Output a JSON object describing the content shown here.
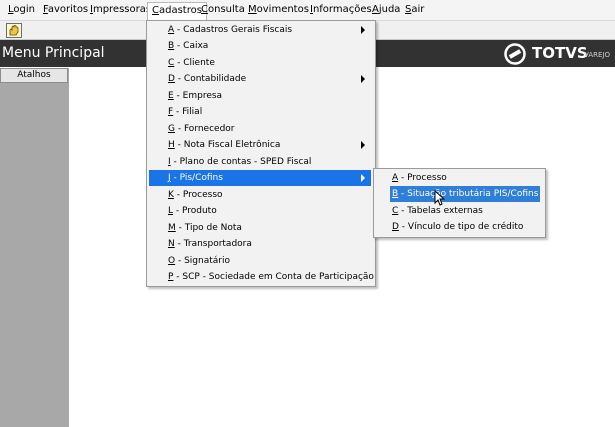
{
  "menubar": {
    "items": [
      {
        "label": "Login",
        "accel": "L",
        "rest": "ogin"
      },
      {
        "label": "Favoritos",
        "accel": "F",
        "rest": "avoritos"
      },
      {
        "label": "Impressoras",
        "accel": "I",
        "rest": "mpressoras"
      },
      {
        "label": "Cadastros",
        "accel": "C",
        "rest": "adastros"
      },
      {
        "label": "Consulta",
        "accel": "C",
        "rest": "onsulta"
      },
      {
        "label": "Movimentos",
        "accel": "M",
        "rest": "ovimentos"
      },
      {
        "label": "Informações",
        "accel": "I",
        "rest": "nformações"
      },
      {
        "label": "Ajuda",
        "accel": "A",
        "rest": "juda"
      },
      {
        "label": "Sair",
        "accel": "S",
        "rest": "air"
      }
    ]
  },
  "toolbar": {
    "button_icon": "hand-icon"
  },
  "header": {
    "title": "Menu Principal",
    "logo_text": "TOTVS",
    "logo_sub": "VAREJO"
  },
  "sidebar": {
    "tab_label": "Atalhos"
  },
  "cadastros_menu": {
    "items": [
      {
        "key": "A",
        "label": " - Cadastros Gerais Fiscais",
        "submenu": true
      },
      {
        "key": "B",
        "label": " - Caixa",
        "submenu": false
      },
      {
        "key": "C",
        "label": " - Cliente",
        "submenu": false
      },
      {
        "key": "D",
        "label": " - Contabilidade",
        "submenu": true
      },
      {
        "key": "E",
        "label": " - Empresa",
        "submenu": false
      },
      {
        "key": "F",
        "label": " - Filial",
        "submenu": false
      },
      {
        "key": "G",
        "label": " - Fornecedor",
        "submenu": false
      },
      {
        "key": "H",
        "label": " - Nota Fiscal Eletrônica",
        "submenu": true
      },
      {
        "key": "I",
        "label": " - Plano de contas - SPED Fiscal",
        "submenu": false
      },
      {
        "key": "J",
        "label": " - Pis/Cofins",
        "submenu": true,
        "highlighted": true
      },
      {
        "key": "K",
        "label": " - Processo",
        "submenu": false
      },
      {
        "key": "L",
        "label": " - Produto",
        "submenu": false
      },
      {
        "key": "M",
        "label": " - Tipo de Nota",
        "submenu": false
      },
      {
        "key": "N",
        "label": " - Transportadora",
        "submenu": false
      },
      {
        "key": "O",
        "label": " - Signatário",
        "submenu": false
      },
      {
        "key": "P",
        "label": " - SCP - Sociedade em Conta de Participação",
        "submenu": false
      }
    ]
  },
  "piscofins_menu": {
    "items": [
      {
        "key": "A",
        "label": " - Processo"
      },
      {
        "key": "B",
        "label": " - Situação tributária PIS/Cofins",
        "highlighted": true
      },
      {
        "key": "C",
        "label": " - Tabelas externas"
      },
      {
        "key": "D",
        "label": " - Vínculo de tipo de crédito"
      }
    ]
  }
}
